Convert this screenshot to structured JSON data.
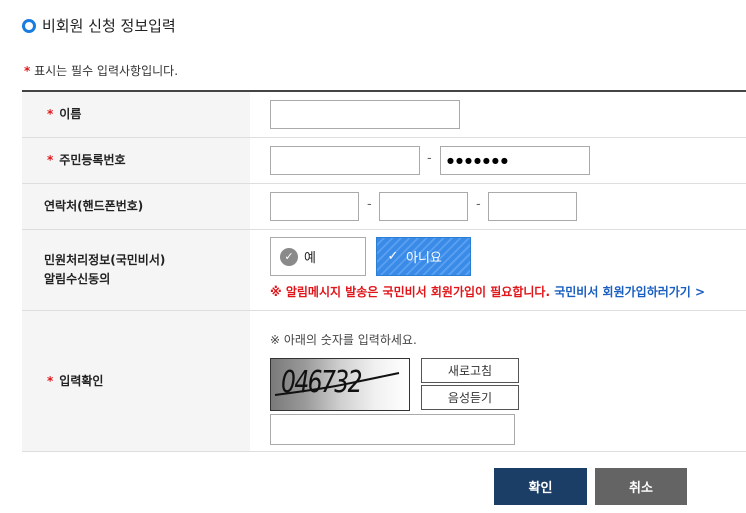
{
  "section": {
    "title": "비회원 신청 정보입력"
  },
  "required_note": {
    "star": "*",
    "text": " 표시는 필수 입력사항입니다."
  },
  "form": {
    "name": {
      "label": "이름",
      "value": ""
    },
    "rrn": {
      "label": "주민등록번호",
      "part1": "",
      "part2": "●●●●●●●"
    },
    "phone": {
      "label": "연락처(핸드폰번호)",
      "part1": "",
      "part2": "",
      "part3": ""
    },
    "consent": {
      "label_line1": "민원처리정보(국민비서)",
      "label_line2": "알림수신동의",
      "option_yes": "예",
      "option_no": "아니요",
      "selected": "아니요",
      "notice_mark": "※",
      "notice_text": " 알림메시지 발송은 국민비서 회원가입이 필요합니다.",
      "notice_link": " 국민비서 회원가입하러가기 >"
    },
    "captcha": {
      "label": "입력확인",
      "instruction": "※ 아래의 숫자를 입력하세요.",
      "code": "046732",
      "refresh_label": "새로고침",
      "audio_label": "음성듣기",
      "input_value": ""
    },
    "dash": "-"
  },
  "buttons": {
    "ok": "확인",
    "cancel": "취소"
  },
  "colors": {
    "accent": "#1a7be0",
    "required": "#e0161b",
    "link": "#1a5fc0",
    "ok_btn": "#1b3e66",
    "cancel_btn": "#646464"
  }
}
